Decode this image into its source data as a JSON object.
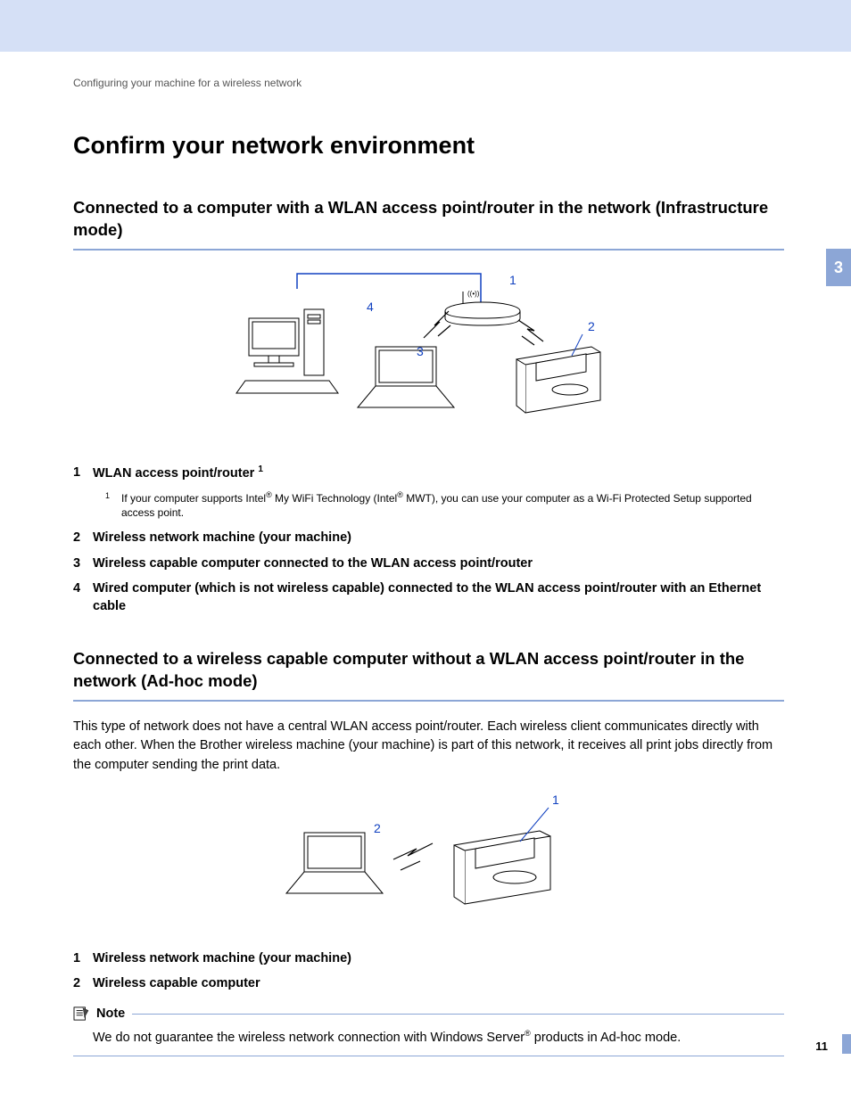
{
  "breadcrumb": "Configuring your machine for a wireless network",
  "section_number": "3",
  "page_number": "11",
  "h1": "Confirm your network environment",
  "sec1": {
    "heading": "Connected to a computer with a WLAN access point/router in the network (Infrastructure mode)",
    "diag": {
      "l1": "1",
      "l2": "2",
      "l3": "3",
      "l4": "4"
    },
    "legend": {
      "i1": {
        "n": "1",
        "text_a": "WLAN access point/router ",
        "sup": "1"
      },
      "fn1": {
        "n": "1",
        "pre": "If your computer supports Intel",
        "mid": " My WiFi Technology (Intel",
        "post": " MWT), you can use your computer as a Wi-Fi Protected Setup supported access point."
      },
      "i2": {
        "n": "2",
        "text": "Wireless network machine (your machine)"
      },
      "i3": {
        "n": "3",
        "text": "Wireless capable computer connected to the WLAN access point/router"
      },
      "i4": {
        "n": "4",
        "text": "Wired computer (which is not wireless capable) connected to the WLAN access point/router with an Ethernet cable"
      }
    }
  },
  "sec2": {
    "heading": "Connected to a wireless capable computer without a WLAN access point/router in the network (Ad-hoc mode)",
    "para": "This type of network does not have a central WLAN access point/router. Each wireless client communicates directly with each other. When the Brother wireless machine (your machine) is part of this network, it receives all print jobs directly from the computer sending the print data.",
    "diag": {
      "l1": "1",
      "l2": "2"
    },
    "legend": {
      "i1": {
        "n": "1",
        "text": "Wireless network machine (your machine)"
      },
      "i2": {
        "n": "2",
        "text": "Wireless capable computer"
      }
    }
  },
  "note": {
    "label": "Note",
    "body_pre": "We do not guarantee the wireless network connection with Windows Server",
    "body_post": " products in Ad-hoc mode."
  }
}
